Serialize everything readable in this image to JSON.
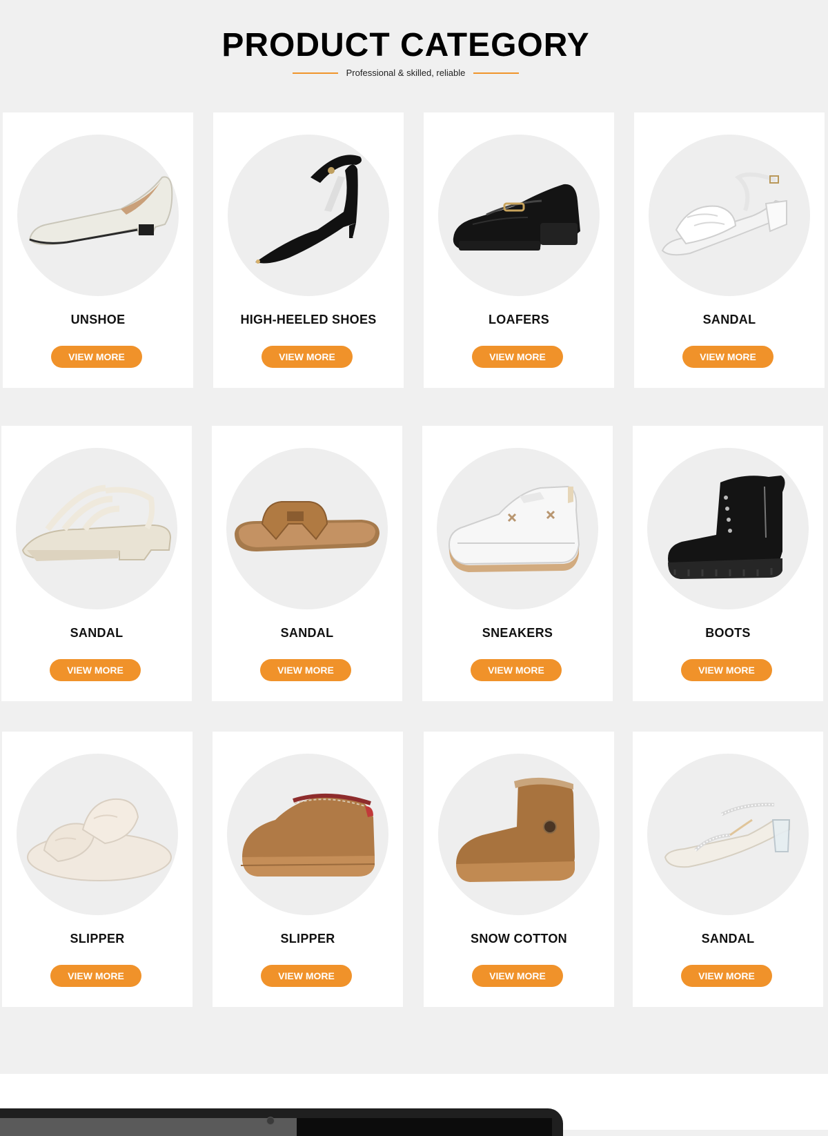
{
  "header": {
    "title": "PRODUCT CATEGORY",
    "subtitle": "Professional & skilled, reliable"
  },
  "colors": {
    "accent": "#f0922a",
    "background": "#f0f0f0",
    "card": "#ffffff",
    "circle": "#eeeeee"
  },
  "categories": [
    {
      "title": "UNSHOE",
      "button": "VIEW MORE",
      "icon": "flat-shoe-icon"
    },
    {
      "title": "HIGH-HEELED SHOES",
      "button": "VIEW MORE",
      "icon": "high-heel-icon"
    },
    {
      "title": "LOAFERS",
      "button": "VIEW MORE",
      "icon": "loafer-icon"
    },
    {
      "title": "SANDAL",
      "button": "VIEW MORE",
      "icon": "heeled-sandal-icon"
    },
    {
      "title": "SANDAL",
      "button": "VIEW MORE",
      "icon": "platform-sandal-icon"
    },
    {
      "title": "SANDAL",
      "button": "VIEW MORE",
      "icon": "slide-sandal-icon"
    },
    {
      "title": "SNEAKERS",
      "button": "VIEW MORE",
      "icon": "sneaker-icon"
    },
    {
      "title": "BOOTS",
      "button": "VIEW MORE",
      "icon": "boot-icon"
    },
    {
      "title": "SLIPPER",
      "button": "VIEW MORE",
      "icon": "fur-slipper-icon"
    },
    {
      "title": "SLIPPER",
      "button": "VIEW MORE",
      "icon": "suede-slipper-icon"
    },
    {
      "title": "SNOW COTTON",
      "button": "VIEW MORE",
      "icon": "snow-boot-icon"
    },
    {
      "title": "SANDAL",
      "button": "VIEW MORE",
      "icon": "clear-heel-sandal-icon"
    }
  ]
}
